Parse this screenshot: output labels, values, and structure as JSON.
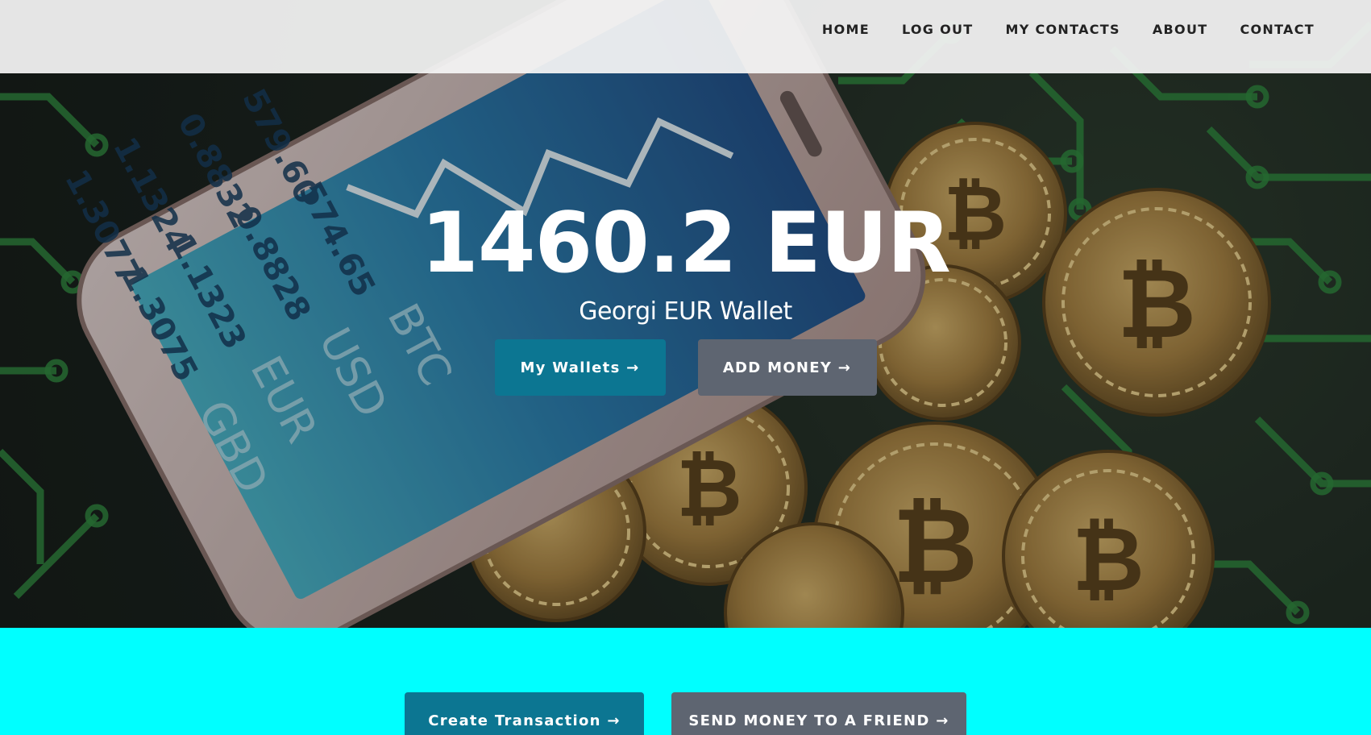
{
  "nav": {
    "items": [
      "HOME",
      "LOG OUT",
      "MY CONTACTS",
      "ABOUT",
      "CONTACT"
    ]
  },
  "hero": {
    "balance": "1460.2 EUR",
    "wallet_name": "Georgi EUR Wallet",
    "my_wallets_label": "My Wallets →",
    "add_money_label": "ADD MONEY →",
    "background_image": {
      "phone_numbers": [
        "579.60",
        "0.8832",
        "1.1324",
        "1.3077",
        "574.65",
        "0.8828",
        "1.1323",
        "1.3075"
      ],
      "currency_codes": [
        "BTC",
        "USD",
        "EUR",
        "GBD"
      ]
    }
  },
  "actions": {
    "create_transaction_label": "Create Transaction →",
    "send_money_label": "SEND MONEY TO A FRIEND →"
  },
  "colors": {
    "primary": "#0c7692",
    "secondary": "#5e6571",
    "section_bg": "#00ffff",
    "navbar_bg": "#f5f5f5",
    "circuit_green": "#2f8a3c"
  }
}
